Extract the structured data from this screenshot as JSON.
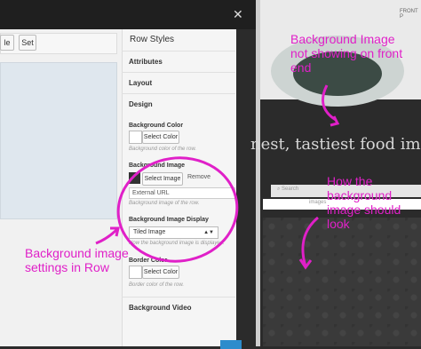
{
  "toolbar": {
    "left_partial": "le",
    "set_label": "Set"
  },
  "panel": {
    "title": "Row Styles",
    "sections": [
      "Attributes",
      "Layout",
      "Design"
    ],
    "background_color": {
      "label": "Background Color",
      "button": "Select Color",
      "desc": "Background color of the row."
    },
    "background_image": {
      "label": "Background Image",
      "button": "Select Image",
      "remove": "Remove",
      "external_url": "External URL",
      "desc": "Background image of the row."
    },
    "background_image_display": {
      "label": "Background Image Display",
      "value": "Tiled Image",
      "desc": "How the background image is displayed."
    },
    "border_color": {
      "label": "Border Color",
      "button": "Select Color",
      "desc": "Border color of the row."
    },
    "background_video": "Background Video"
  },
  "preview": {
    "front_label": "FRONT P",
    "tagline": "nest, tastiest food im",
    "search_placeholder": "Search",
    "images_label": "images"
  },
  "annotations": {
    "top_right": "Background Image not showing on front end",
    "mid_right": "How the background image should look",
    "left": "Background image settings in Row"
  },
  "colors": {
    "annotation": "#e020c8",
    "button_blue": "#2d8ccc"
  }
}
